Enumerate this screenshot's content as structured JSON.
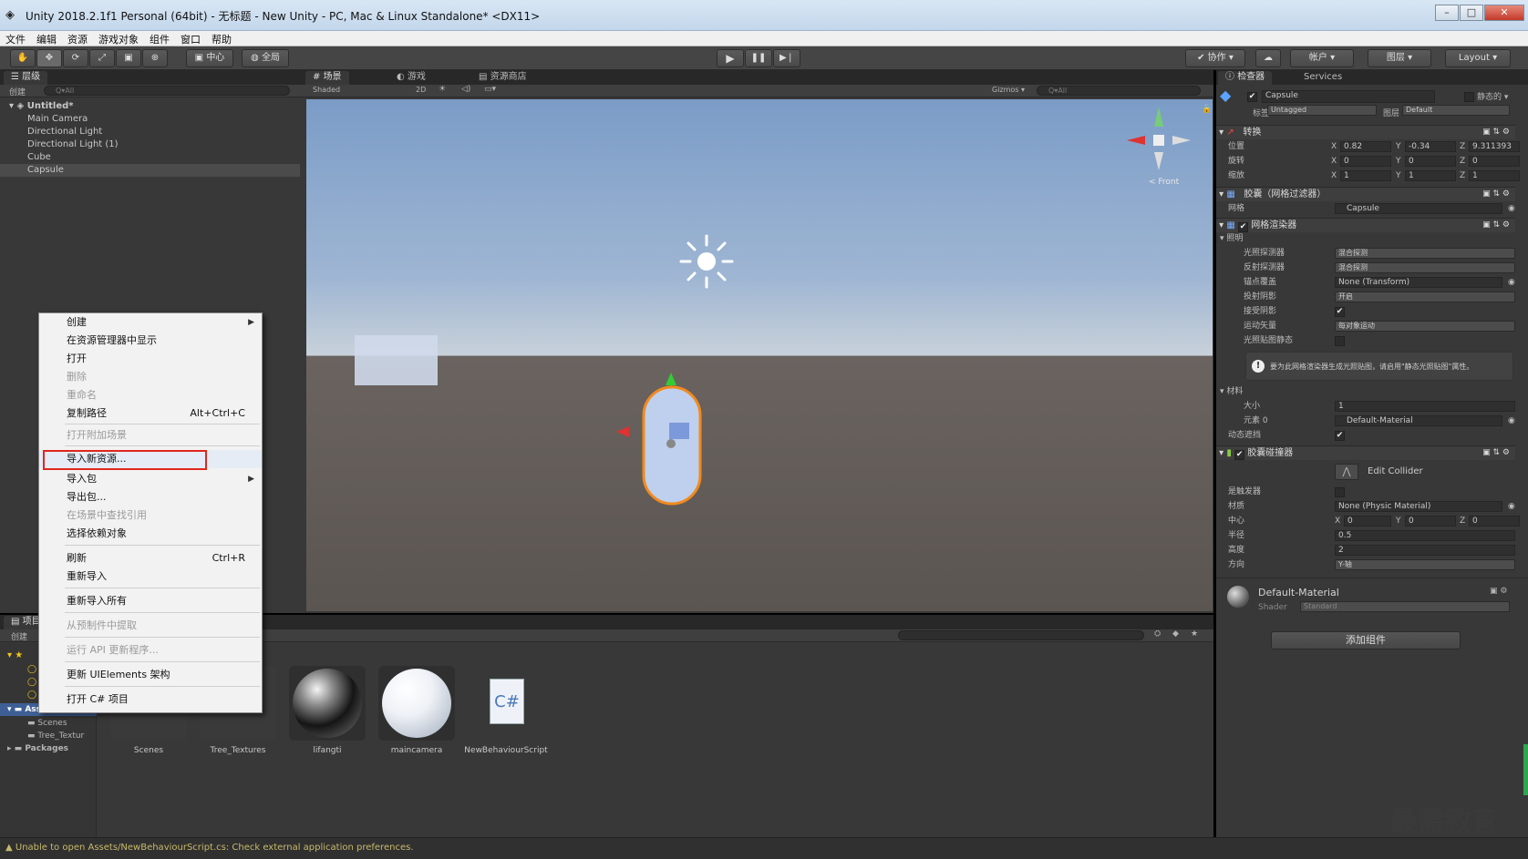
{
  "window": {
    "title": "Unity 2018.2.1f1 Personal (64bit) - 无标题 - New Unity - PC, Mac & Linux Standalone* <DX11>"
  },
  "menubar": [
    "文件",
    "编辑",
    "资源",
    "游戏对象",
    "组件",
    "窗口",
    "帮助"
  ],
  "toolbar": {
    "pivot": "中心",
    "global": "全局",
    "collab": "协作",
    "account": "帐户",
    "layers": "图层",
    "layout": "Layout"
  },
  "hierarchy": {
    "tab": "层级",
    "create": "创建",
    "search": "Q▾All",
    "scene": "Untitled*",
    "items": [
      "Main Camera",
      "Directional Light",
      "Directional Light (1)",
      "Cube",
      "Capsule"
    ]
  },
  "scene": {
    "tabs": [
      "场景",
      "游戏",
      "资源商店"
    ],
    "shading": "Shaded",
    "mode2d": "2D",
    "gizmos": "Gizmos",
    "search": "Q▾All",
    "view": "Front"
  },
  "context_menu": {
    "items": [
      {
        "label": "创建",
        "enabled": true,
        "submenu": true
      },
      {
        "label": "在资源管理器中显示",
        "enabled": true
      },
      {
        "label": "打开",
        "enabled": true
      },
      {
        "label": "删除",
        "enabled": false
      },
      {
        "label": "重命名",
        "enabled": false
      },
      {
        "label": "复制路径",
        "enabled": true,
        "shortcut": "Alt+Ctrl+C"
      },
      {
        "label": "打开附加场景",
        "enabled": false
      },
      {
        "label": "导入新资源...",
        "enabled": true,
        "highlighted": true
      },
      {
        "label": "导入包",
        "enabled": true,
        "submenu": true
      },
      {
        "label": "导出包...",
        "enabled": true
      },
      {
        "label": "在场景中查找引用",
        "enabled": false
      },
      {
        "label": "选择依赖对象",
        "enabled": true
      },
      {
        "label": "刷新",
        "enabled": true,
        "shortcut": "Ctrl+R"
      },
      {
        "label": "重新导入",
        "enabled": true
      },
      {
        "label": "重新导入所有",
        "enabled": true
      },
      {
        "label": "从预制件中提取",
        "enabled": false
      },
      {
        "label": "运行 API 更新程序...",
        "enabled": false
      },
      {
        "label": "更新 UIElements 架构",
        "enabled": true
      },
      {
        "label": "打开 C# 项目",
        "enabled": true
      }
    ]
  },
  "project": {
    "tab": "项目",
    "create": "创建",
    "tree": [
      "Assets",
      "Scenes",
      "Tree_Textur",
      "Packages"
    ],
    "assets": [
      {
        "name": "Scenes",
        "kind": "folder"
      },
      {
        "name": "Tree_Textures",
        "kind": "folder"
      },
      {
        "name": "lifangti",
        "kind": "material-dark"
      },
      {
        "name": "maincamera",
        "kind": "material-white"
      },
      {
        "name": "NewBehaviourScript",
        "kind": "script",
        "glyph": "C#"
      }
    ]
  },
  "inspector": {
    "tabs": [
      "检查器",
      "Services"
    ],
    "object": "Capsule",
    "static": "静态的",
    "tag_label": "标签",
    "tag": "Untagged",
    "layer_label": "图层",
    "layer": "Default",
    "transform": {
      "title": "转换",
      "position_label": "位置",
      "position": [
        "0.82",
        "-0.34",
        "9.311393"
      ],
      "rotation_label": "旋转",
      "rotation": [
        "0",
        "0",
        "0"
      ],
      "scale_label": "缩放",
      "scale": [
        "1",
        "1",
        "1"
      ]
    },
    "mesh_filter": {
      "title": "胶囊（网格过滤器）",
      "mesh_label": "网格",
      "mesh": "Capsule"
    },
    "mesh_renderer": {
      "title": "网格渲染器",
      "lighting": "照明",
      "rows": [
        {
          "label": "光照探测器",
          "value": "混合探测"
        },
        {
          "label": "反射探测器",
          "value": "混合探测"
        },
        {
          "label": "锚点覆盖",
          "value": "None (Transform)"
        },
        {
          "label": "投射阴影",
          "value": "开启"
        },
        {
          "label": "接受阴影",
          "value": ""
        },
        {
          "label": "运动矢量",
          "value": "每对象运动"
        },
        {
          "label": "光照贴图静态",
          "value": ""
        }
      ],
      "note": "要为此网格渲染器生成光照贴图，请启用\"静态光照贴图\"属性。",
      "materials_label": "材料",
      "size_label": "大小",
      "size": "1",
      "element_label": "元素 0",
      "element": "Default-Material",
      "dynamic_occluded": "动态遮挡"
    },
    "capsule_collider": {
      "title": "胶囊碰撞器",
      "edit": "Edit Collider",
      "trigger_label": "是触发器",
      "material_label": "材质",
      "material": "None (Physic Material)",
      "center_label": "中心",
      "center": [
        "0",
        "0",
        "0"
      ],
      "radius_label": "半径",
      "radius": "0.5",
      "height_label": "高度",
      "height": "2",
      "direction_label": "方向",
      "direction": "Y-轴"
    },
    "material": {
      "name": "Default-Material",
      "shader_label": "Shader",
      "shader": "Standard"
    },
    "add_component": "添加组件"
  },
  "status": {
    "message": "Unable to open Assets/NewBehaviourScript.cs: Check external application preferences."
  },
  "watermark": "最需教育"
}
